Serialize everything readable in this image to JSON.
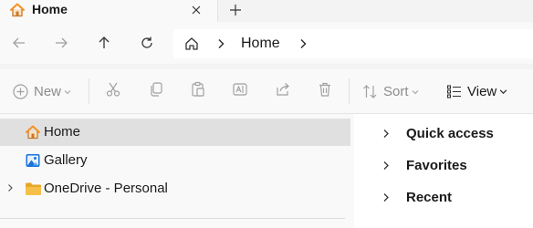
{
  "tab": {
    "title": "Home",
    "close_label": "×",
    "new_tab_label": "+"
  },
  "address": {
    "current": "Home"
  },
  "toolbar": {
    "new_label": "New",
    "sort_label": "Sort",
    "view_label": "View"
  },
  "nav": {
    "items": [
      {
        "label": "Home",
        "icon": "home-icon",
        "selected": true
      },
      {
        "label": "Gallery",
        "icon": "gallery-icon",
        "selected": false
      },
      {
        "label": "OneDrive - Personal",
        "icon": "folder-icon",
        "selected": false
      }
    ]
  },
  "content": {
    "sections": [
      {
        "label": "Quick access"
      },
      {
        "label": "Favorites"
      },
      {
        "label": "Recent"
      }
    ]
  },
  "colors": {
    "home_orange": "#f7931e",
    "folder_yellow": "#f5c04a",
    "gallery_blue": "#1a73d9",
    "disabled_icon": "#a0a0a0",
    "selected_row": "#e0e0e0"
  }
}
